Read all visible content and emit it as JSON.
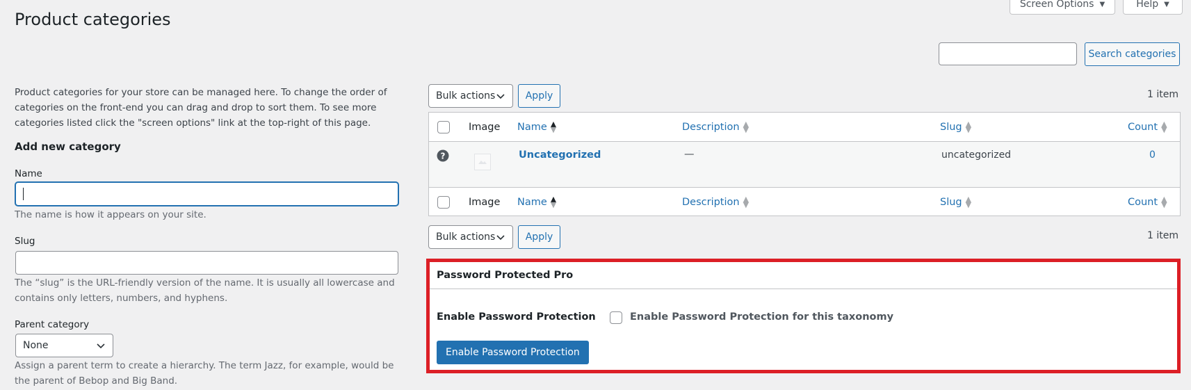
{
  "header": {
    "title": "Product categories",
    "screen_options": "Screen Options",
    "help": "Help"
  },
  "search": {
    "value": "",
    "button": "Search categories"
  },
  "left": {
    "description": "Product categories for your store can be managed here. To change the order of categories on the front-end you can drag and drop to sort them. To see more categories listed click the \"screen options\" link at the top-right of this page.",
    "form_title": "Add new category",
    "name_label": "Name",
    "name_value": "",
    "name_help": "The name is how it appears on your site.",
    "slug_label": "Slug",
    "slug_value": "",
    "slug_help": "The “slug” is the URL-friendly version of the name. It is usually all lowercase and contains only letters, numbers, and hyphens.",
    "parent_label": "Parent category",
    "parent_selected": "None",
    "parent_help": "Assign a parent term to create a hierarchy. The term Jazz, for example, would be the parent of Bebop and Big Band."
  },
  "table": {
    "bulk_actions": "Bulk actions",
    "apply": "Apply",
    "item_count": "1 item",
    "columns": {
      "image": "Image",
      "name": "Name",
      "description": "Description",
      "slug": "Slug",
      "count": "Count"
    },
    "rows": [
      {
        "name": "Uncategorized",
        "description": "—",
        "slug": "uncategorized",
        "count": "0"
      }
    ]
  },
  "password_box": {
    "title": "Password Protected Pro",
    "field_label": "Enable Password Protection",
    "checkbox_label": "Enable Password Protection for this taxonomy",
    "checkbox_checked": false,
    "button": "Enable Password Protection"
  },
  "colors": {
    "accent": "#2271b1",
    "highlight_border": "#dc1f26",
    "background": "#f0f0f1"
  },
  "icons": {
    "help_circle": "help-circle-icon",
    "placeholder_image": "image-placeholder-icon",
    "sort": "sort-arrows-icon",
    "dropdown": "chevron-down-icon"
  }
}
